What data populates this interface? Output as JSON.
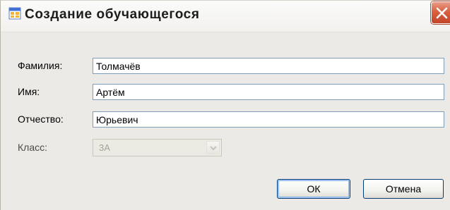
{
  "window": {
    "title": "Создание обучающегося",
    "app_icon": "window-app-icon",
    "close_icon": "close-icon"
  },
  "form": {
    "surname_label": "Фамилия:",
    "surname_value": "Толмачёв",
    "name_label": "Имя:",
    "name_value": "Артём",
    "patronymic_label": "Отчество:",
    "patronymic_value": "Юрьевич",
    "class_label": "Класс:",
    "class_value": "3А",
    "class_enabled": false
  },
  "buttons": {
    "ok_label": "ОК",
    "cancel_label": "Отмена"
  },
  "colors": {
    "close_button": "#d9603f",
    "input_border": "#7f9db9",
    "button_border": "#003c74",
    "window_bg": "#eceae6"
  }
}
